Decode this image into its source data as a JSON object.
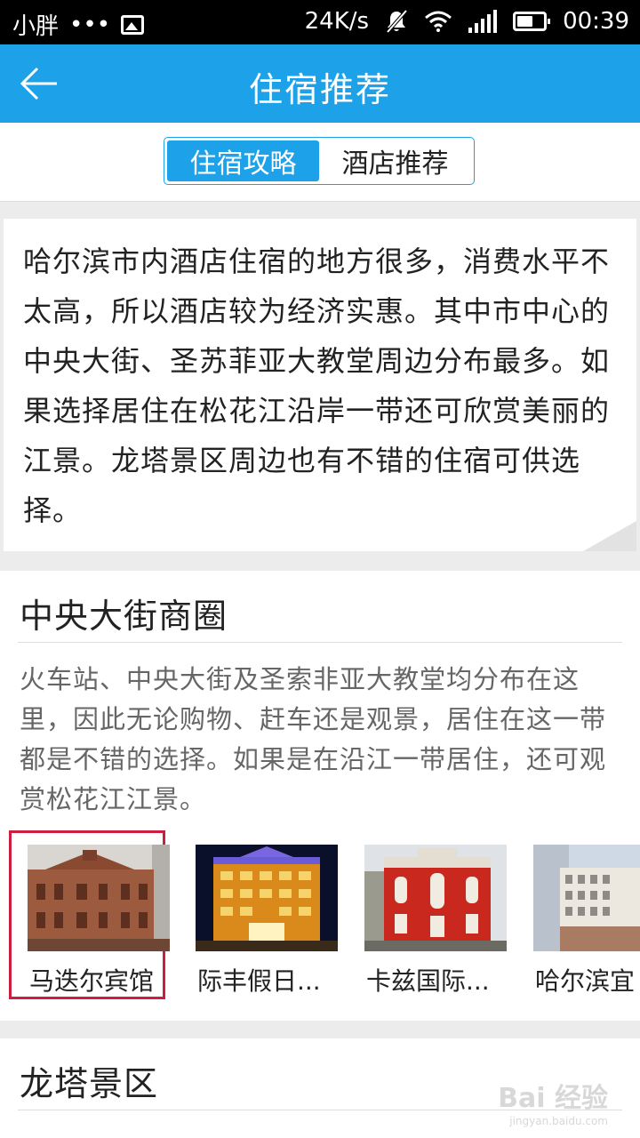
{
  "status_bar": {
    "carrier": "小胖",
    "dots": "•••",
    "speed": "24K/s",
    "time": "00:39",
    "icons": [
      "image-icon",
      "mute-icon",
      "wifi-icon",
      "signal-icon",
      "battery-icon"
    ]
  },
  "header": {
    "title": "住宿推荐",
    "back_icon": "arrow-left-icon",
    "color": "#1da1e8"
  },
  "tabs": [
    {
      "label": "住宿攻略",
      "active": true
    },
    {
      "label": "酒店推荐",
      "active": false
    }
  ],
  "intro": {
    "text": "哈尔滨市内酒店住宿的地方很多，消费水平不太高，所以酒店较为经济实惠。其中市中心的中央大街、圣苏菲亚大教堂周边分布最多。如果选择居住在松花江沿岸一带还可欣赏美丽的江景。龙塔景区周边也有不错的住宿可供选择。"
  },
  "sections": [
    {
      "title": "中央大街商圈",
      "description": "火车站、中央大街及圣索非亚大教堂均分布在这里，因此无论购物、赶车还是观景，居住在这一带都是不错的选择。如果是在沿江一带居住，还可观赏松花江江景。",
      "hotels": [
        {
          "name": "马迭尔宾馆",
          "selected": true
        },
        {
          "name": "际丰假日...",
          "selected": false
        },
        {
          "name": "卡兹国际...",
          "selected": false
        },
        {
          "name": "哈尔滨宜",
          "selected": false
        }
      ]
    },
    {
      "title": "龙塔景区"
    }
  ],
  "watermark": {
    "brand": "Bai 经验",
    "url": "jingyan.baidu.com"
  }
}
